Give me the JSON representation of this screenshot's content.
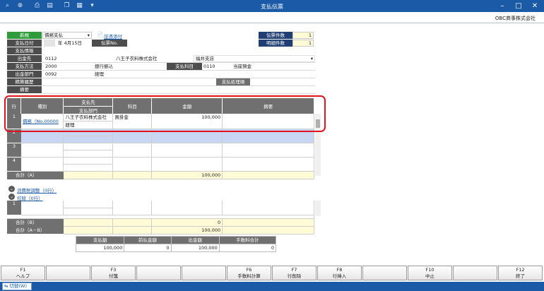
{
  "window": {
    "title": "支払伝票",
    "company": "OBC商事株式会社"
  },
  "toolbar_icons": [
    "search-add-icon",
    "zoom-icon",
    "print-icon",
    "print-preview-icon",
    "copy-icon",
    "layout-icon"
  ],
  "header": {
    "new_label": "新規",
    "slip_type": "債務支払",
    "attach_label": "証憑添付",
    "pay_date_label": "支払日付",
    "pay_date_value": "年  4月15日",
    "slip_no_label": "伝票No.",
    "pay_info_label": "支払情報",
    "payee_label": "出金先",
    "payee_code": "0112",
    "payee_name": "八王子衣料株式会社",
    "branch": "福井支店",
    "method_label": "支払方法",
    "method_code": "2000",
    "method_name": "銀行振込",
    "account_label": "支払科目",
    "account_code": "0110",
    "account_name": "当座預金",
    "dept_label": "出金部門",
    "dept_code": "0092",
    "dept_name": "経理",
    "settle_label": "精算履歴",
    "process_btn": "支払処理順",
    "memo_label": "摘要"
  },
  "counts": {
    "slip_count_label": "伝票件数",
    "slip_count": "1",
    "detail_count_label": "明細件数",
    "detail_count": "1"
  },
  "grid": {
    "headers": {
      "row": "行",
      "kind": "種別",
      "payee": "支払先",
      "dept": "支払部門",
      "account": "科目",
      "amount": "金額",
      "memo": "摘要"
    },
    "rows": [
      {
        "num": "1",
        "kind": "債務（No.00000",
        "payee": "八王子衣料株式会社",
        "dept": "経理",
        "account": "買掛金",
        "amount": "100,000",
        "memo": ""
      },
      {
        "num": "2",
        "kind": "",
        "payee": "",
        "dept": "",
        "account": "",
        "amount": "",
        "memo": ""
      },
      {
        "num": "3",
        "kind": "",
        "payee": "",
        "dept": "",
        "account": "",
        "amount": "",
        "memo": ""
      },
      {
        "num": "4",
        "kind": "",
        "payee": "",
        "dept": "",
        "account": "",
        "amount": "",
        "memo": ""
      }
    ],
    "total_a_label": "合計（A）",
    "total_a": "100,000"
  },
  "sections": {
    "tax_adjust": "消費税調整（0行）",
    "deduction": "控除（0行）"
  },
  "deduct_grid": {
    "rows": [
      {
        "num": "1"
      }
    ],
    "total_b_label": "合計（B）",
    "total_b": "0",
    "total_ab_label": "合計（A－B）",
    "total_ab": "100,000"
  },
  "summary": {
    "headers": [
      "支払額",
      "前払金額",
      "出金額",
      "手数料合計"
    ],
    "values": [
      "100,000",
      "0",
      "100,000",
      "0"
    ]
  },
  "fkeys": [
    {
      "key": "F1",
      "label": "ヘルプ"
    },
    {
      "key": "",
      "label": ""
    },
    {
      "key": "F3",
      "label": "付箋"
    },
    {
      "key": "",
      "label": ""
    },
    {
      "key": "",
      "label": ""
    },
    {
      "key": "F6",
      "label": "手数料計算"
    },
    {
      "key": "F7",
      "label": "行削除"
    },
    {
      "key": "F8",
      "label": "行挿入"
    },
    {
      "key": "",
      "label": ""
    },
    {
      "key": "F10",
      "label": "中止"
    },
    {
      "key": "",
      "label": ""
    },
    {
      "key": "F12",
      "label": "終了"
    }
  ],
  "status": {
    "switch_label": "切替(W)"
  }
}
